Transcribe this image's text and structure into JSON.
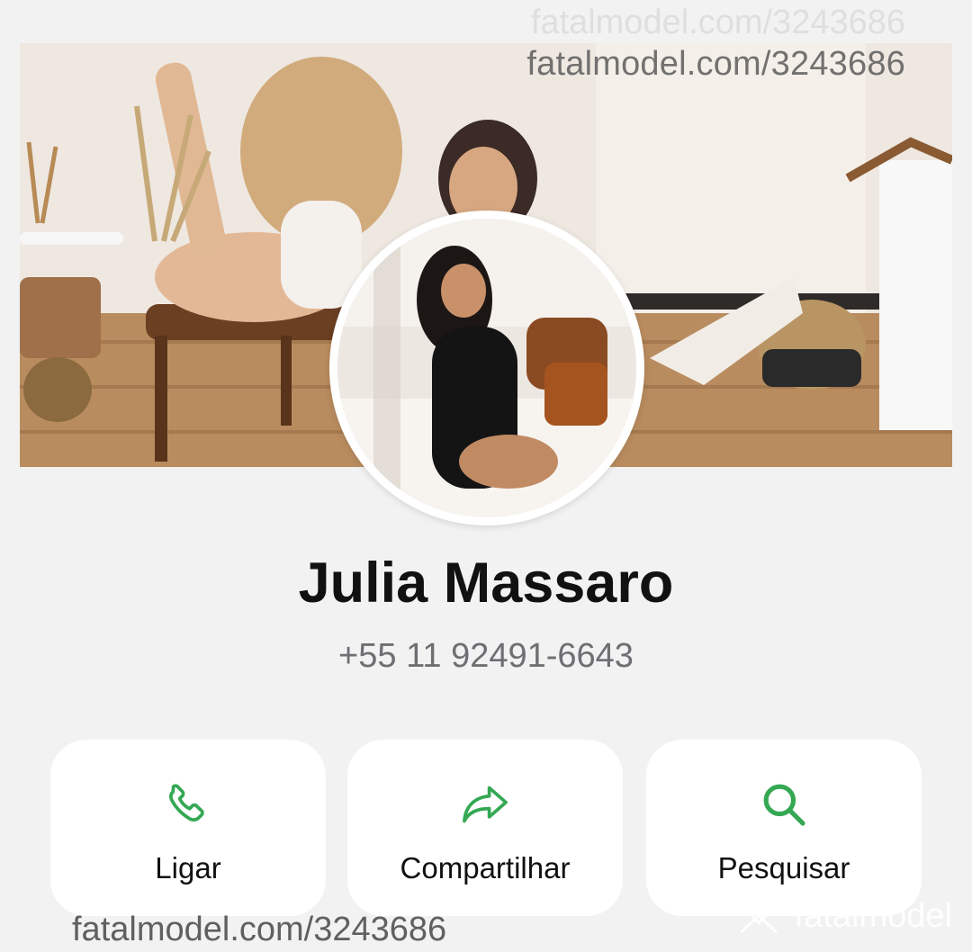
{
  "cover": {
    "watermark": "fatalmodel.com/3243686"
  },
  "profile": {
    "name": "Julia Massaro",
    "phone": "+55 11 92491-6643"
  },
  "actions": [
    {
      "label": "Ligar",
      "icon": "phone-icon"
    },
    {
      "label": "Compartilhar",
      "icon": "share-arrow-icon"
    },
    {
      "label": "Pesquisar",
      "icon": "search-icon"
    }
  ],
  "footer": {
    "watermark": "fatalmodel.com/3243686",
    "brand": "fatalmodel"
  },
  "colors": {
    "accent_green": "#34a853",
    "background": "#f2f2f2",
    "text_primary": "#111111",
    "text_secondary": "#6e6e73"
  }
}
